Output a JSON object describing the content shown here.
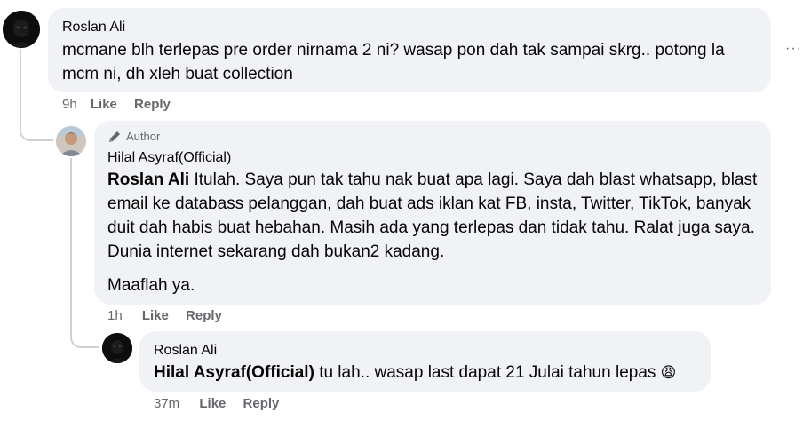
{
  "comment1": {
    "author": "Roslan Ali",
    "text": "mcmane blh terlepas pre order nirnama 2 ni? wasap pon dah tak sampai skrg.. potong la mcm ni, dh xleh buat collection",
    "time": "9h",
    "like_label": "Like",
    "reply_label": "Reply",
    "more_options": "···"
  },
  "reply1": {
    "author_badge": "Author",
    "author": "Hilal Asyraf(Official)",
    "mention": "Roslan Ali",
    "text_part1": "Itulah. Saya pun tak tahu nak buat apa lagi. Saya dah blast whatsapp, blast email ke databass pelanggan, dah buat ads iklan kat FB, insta, Twitter, TikTok, banyak duit dah habis buat hebahan. Masih ada yang terlepas dan tidak tahu. Ralat juga saya. Dunia internet sekarang dah bukan2 kadang.",
    "text_part2": "Maaflah ya.",
    "time": "1h",
    "like_label": "Like",
    "reply_label": "Reply"
  },
  "reply2": {
    "author": "Roslan Ali",
    "mention": "Hilal Asyraf(Official)",
    "text": "tu lah.. wasap last dapat 21 Julai tahun lepas",
    "emoji": "😩",
    "time": "37m",
    "like_label": "Like",
    "reply_label": "Reply"
  }
}
